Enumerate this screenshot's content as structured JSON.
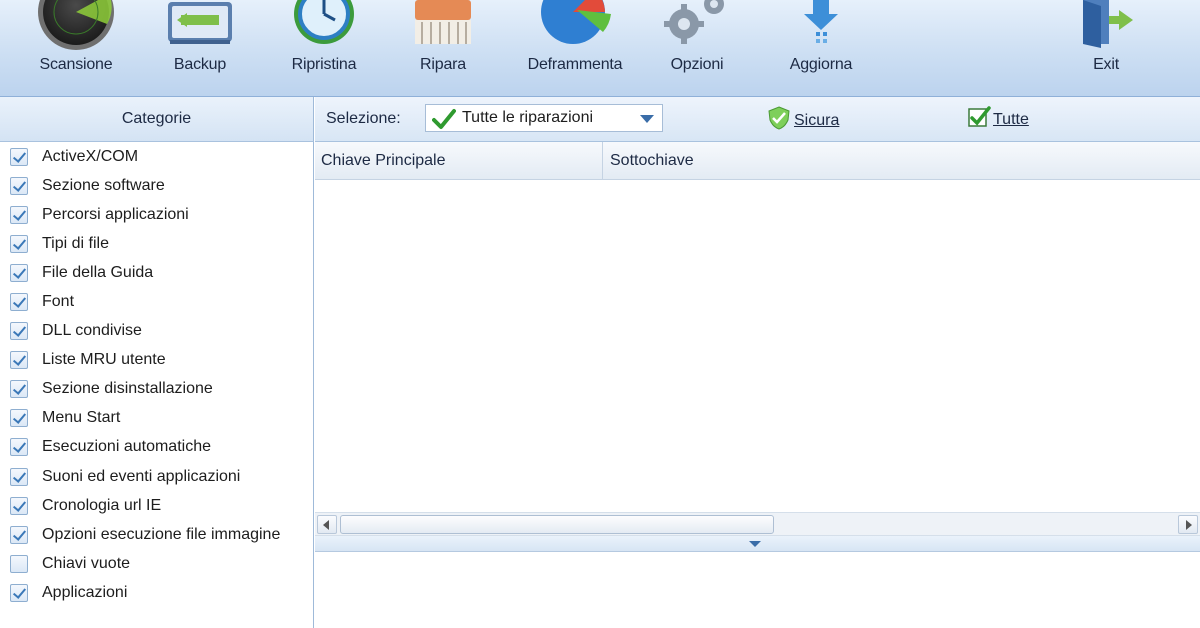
{
  "toolbar": {
    "items": [
      {
        "label": "Scansione",
        "icon": "radar-icon"
      },
      {
        "label": "Backup",
        "icon": "backup-icon"
      },
      {
        "label": "Ripristina",
        "icon": "clock-icon"
      },
      {
        "label": "Ripara",
        "icon": "brush-icon"
      },
      {
        "label": "Deframmenta",
        "icon": "pie-chart-icon"
      },
      {
        "label": "Opzioni",
        "icon": "gear-icon"
      },
      {
        "label": "Aggiorna",
        "icon": "download-icon"
      },
      {
        "label": "Exit",
        "icon": "exit-door-icon"
      }
    ]
  },
  "categories": {
    "header": "Categorie",
    "items": [
      {
        "label": "ActiveX/COM",
        "checked": true
      },
      {
        "label": "Sezione software",
        "checked": true
      },
      {
        "label": "Percorsi applicazioni",
        "checked": true
      },
      {
        "label": "Tipi di file",
        "checked": true
      },
      {
        "label": "File della Guida",
        "checked": true
      },
      {
        "label": "Font",
        "checked": true
      },
      {
        "label": "DLL condivise",
        "checked": true
      },
      {
        "label": "Liste MRU utente",
        "checked": true
      },
      {
        "label": "Sezione disinstallazione",
        "checked": true
      },
      {
        "label": "Menu Start",
        "checked": true
      },
      {
        "label": "Esecuzioni automatiche",
        "checked": true
      },
      {
        "label": "Suoni ed eventi applicazioni",
        "checked": true
      },
      {
        "label": "Cronologia url IE",
        "checked": true
      },
      {
        "label": "Opzioni esecuzione file immagine",
        "checked": true
      },
      {
        "label": "Chiavi vuote",
        "checked": false
      },
      {
        "label": "Applicazioni",
        "checked": true
      }
    ]
  },
  "selection": {
    "label": "Selezione:",
    "value": "Tutte le riparazioni",
    "safe_label": "Sicura",
    "all_label": "Tutte"
  },
  "grid": {
    "columns": [
      "Chiave Principale",
      "Sottochiave"
    ]
  },
  "colors": {
    "accent": "#3b78b8",
    "check_green": "#2f9a2f"
  }
}
